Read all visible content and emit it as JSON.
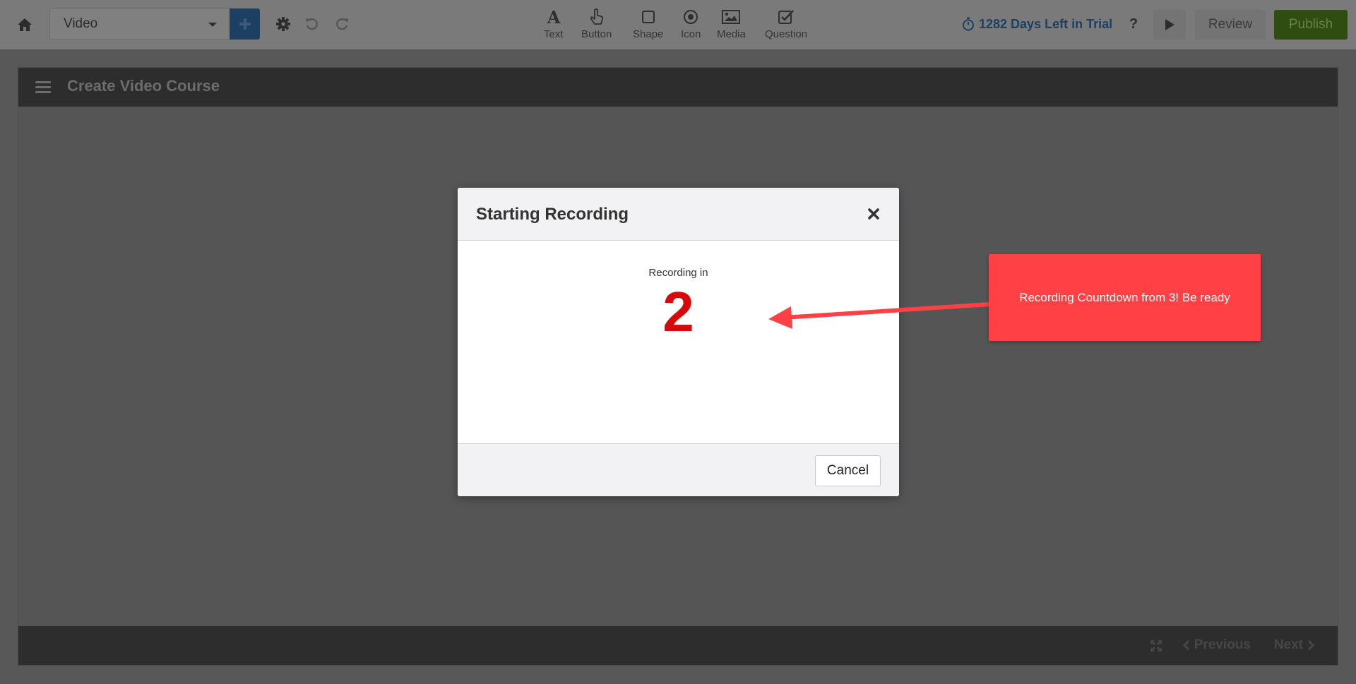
{
  "toolbar": {
    "select_value": "Video",
    "tools": [
      {
        "label": "Text",
        "icon": "text-icon"
      },
      {
        "label": "Button",
        "icon": "hand-pointer-icon"
      },
      {
        "label": "Shape",
        "icon": "square-icon"
      },
      {
        "label": "Icon",
        "icon": "dot-circle-icon"
      },
      {
        "label": "Media",
        "icon": "image-icon"
      },
      {
        "label": "Question",
        "icon": "check-square-icon"
      }
    ],
    "trial_text": "1282 Days Left in Trial",
    "help_label": "?",
    "review_label": "Review",
    "publish_label": "Publish"
  },
  "canvas": {
    "title": "Create Video Course",
    "prev_label": "Previous",
    "next_label": "Next"
  },
  "modal": {
    "title": "Starting Recording",
    "recording_label": "Recording in",
    "countdown": "2",
    "cancel_label": "Cancel"
  },
  "annotation": {
    "text": "Recording Countdown from 3! Be ready"
  },
  "colors": {
    "accent_blue": "#1c3f64",
    "publish_green": "#2f4d10",
    "countdown_red": "#d60a0a",
    "callout_red": "#ff4045"
  }
}
